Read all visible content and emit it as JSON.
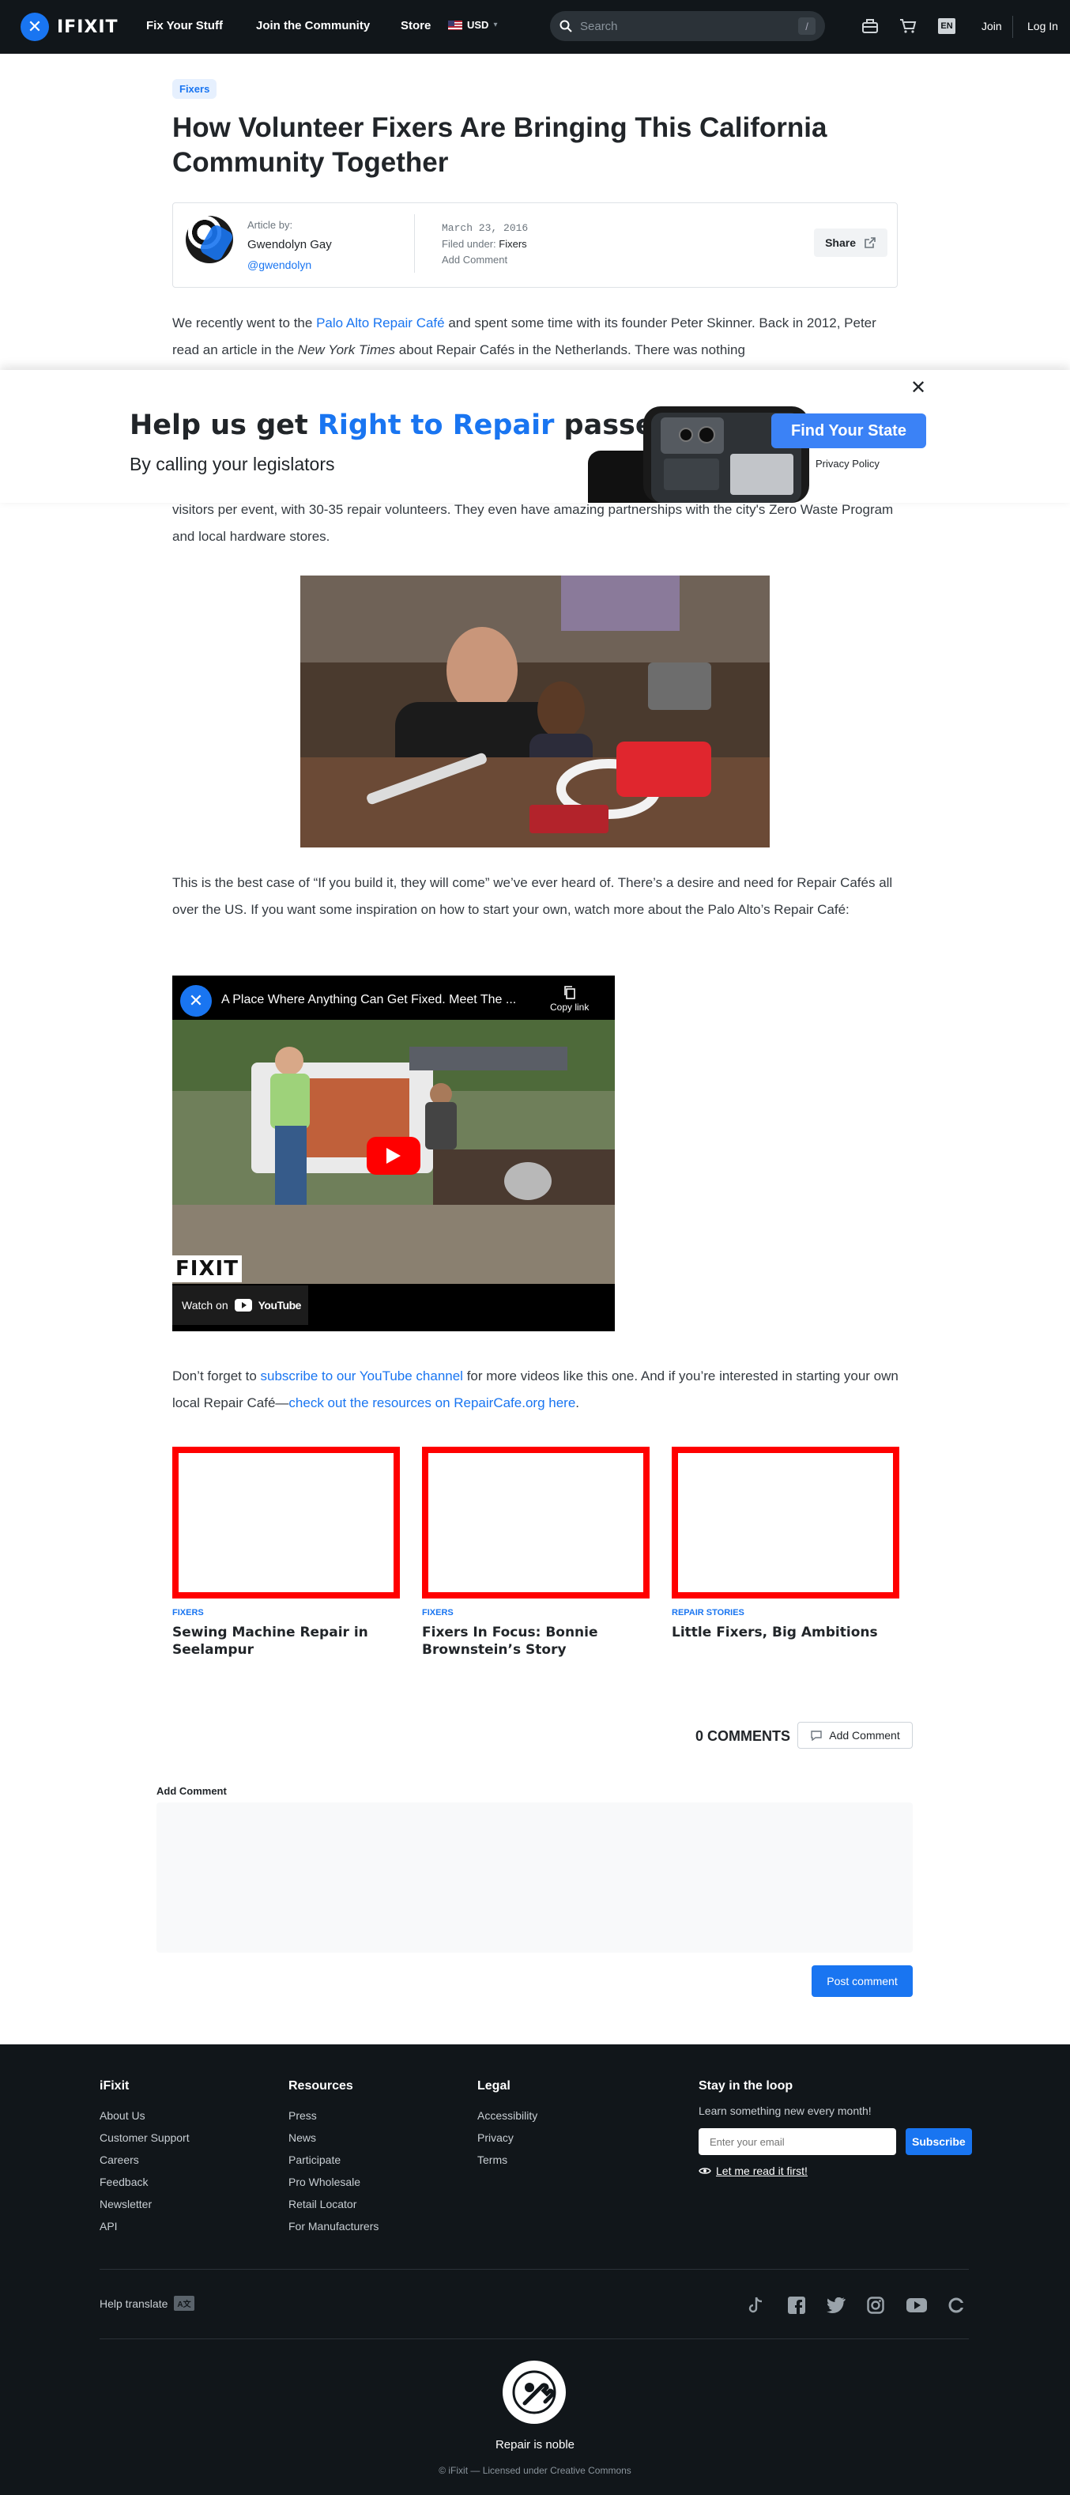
{
  "nav": {
    "logo_text": "IFIXIT",
    "links": [
      "Fix Your Stuff",
      "Join the Community",
      "Store"
    ],
    "currency": "USD",
    "search_placeholder": "Search",
    "search_shortcut": "/",
    "lang": "EN",
    "join": "Join",
    "login": "Log In"
  },
  "article": {
    "category": "Fixers",
    "title": "How Volunteer Fixers Are Bringing This California Community Together",
    "author_label": "Article by:",
    "author_name": "Gwendolyn Gay",
    "author_handle": "@gwendolyn",
    "date": "March 23, 2016",
    "filed_label": "Filed under:",
    "filed_value": "Fixers",
    "add_comment": "Add Comment",
    "share": "Share",
    "p1_a": "We recently went to the ",
    "p1_link": "Palo Alto Repair Café",
    "p1_b": " and spent some time with its founder Peter Skinner. Back in 2012, Peter read an article in the ",
    "p1_italic": "New York Times",
    "p1_c": " about Repair Cafés in the Netherlands. There was nothing",
    "p2": "visitors per event, with 30-35 repair volunteers. They even have amazing partnerships with the city's Zero Waste Program and local hardware stores.",
    "p3": "This is the best case of “If you build it, they will come” we’ve ever heard of. There’s a desire and need for Repair Cafés all over the US. If you want some inspiration on how to start your own, watch more about the Palo Alto’s Repair Café:",
    "p4_a": "Don’t forget to ",
    "p4_link1": "subscribe to our YouTube channel",
    "p4_b": " for more videos like this one. And if you’re interested in starting your own local Repair Café—",
    "p4_link2": "check out the resources on RepairCafe.org here",
    "p4_c": "."
  },
  "banner": {
    "h_a": "Help us get ",
    "h_hl": "Right to Repair",
    "h_b": " passed",
    "sub": "By calling your legislators",
    "button": "Find Your State",
    "privacy": "Privacy Policy",
    "close": "✕"
  },
  "video": {
    "title": "A Place Where Anything Can Get Fixed. Meet The ...",
    "copy": "Copy link",
    "brand": "FIXIT",
    "watch": "Watch on",
    "yt": "YouTube"
  },
  "related": [
    {
      "tag": "FIXERS",
      "title": "Sewing Machine Repair in Seelampur"
    },
    {
      "tag": "FIXERS",
      "title": "Fixers In Focus: Bonnie Brownstein’s Story"
    },
    {
      "tag": "REPAIR STORIES",
      "title": "Little Fixers, Big Ambitions"
    }
  ],
  "comments": {
    "count": "0 COMMENTS",
    "add": "Add Comment",
    "label": "Add Comment",
    "post": "Post comment"
  },
  "footer": {
    "cols": [
      {
        "head": "iFixit",
        "links": [
          "About Us",
          "Customer Support",
          "Careers",
          "Feedback",
          "Newsletter",
          "API"
        ]
      },
      {
        "head": "Resources",
        "links": [
          "Press",
          "News",
          "Participate",
          "Pro Wholesale",
          "Retail Locator",
          "For Manufacturers"
        ]
      },
      {
        "head": "Legal",
        "links": [
          "Accessibility",
          "Privacy",
          "Terms"
        ]
      }
    ],
    "stay_head": "Stay in the loop",
    "stay_text": "Learn something new every month!",
    "email_placeholder": "Enter your email",
    "subscribe": "Subscribe",
    "read_it": "Let me read it first!",
    "help_translate": "Help translate",
    "noble": "Repair is noble",
    "license": "© iFixit — Licensed under Creative Commons"
  },
  "colors": {
    "accent": "#1975f1",
    "nav_bg": "#11161a",
    "red_frame": "#ff0000"
  }
}
